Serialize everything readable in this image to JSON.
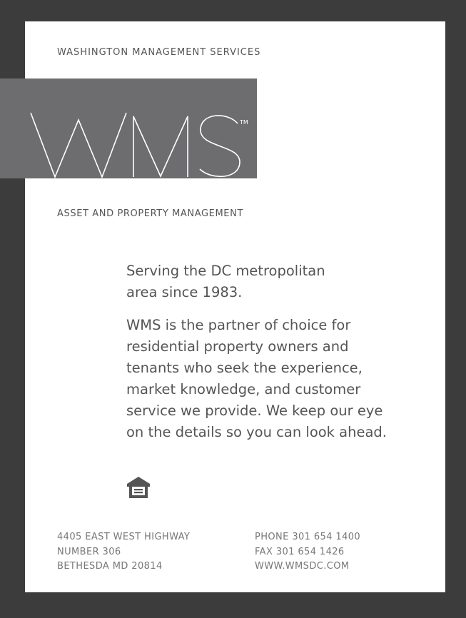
{
  "header": {
    "company_name": "WASHINGTON MANAGEMENT SERVICES"
  },
  "logo": {
    "mark": "WMS",
    "trademark": "TM",
    "block_color": "#6d6d70"
  },
  "tagline": "ASSET AND PROPERTY MANAGEMENT",
  "body": {
    "intro_lines": [
      "Serving the DC metropolitan",
      "area since 1983."
    ],
    "description_lines": [
      "WMS is the partner of choice for",
      "residential property owners and",
      "tenants who seek the experience,",
      "market knowledge, and customer",
      "service we provide. We keep our eye",
      "on the details so you can look ahead."
    ]
  },
  "icon": {
    "name": "equal-housing-opportunity-icon"
  },
  "footer": {
    "address": {
      "line1": "4405 EAST WEST HIGHWAY",
      "line2": "NUMBER 306",
      "line3": "BETHESDA MD 20814"
    },
    "contact": {
      "phone": "PHONE 301 654 1400",
      "fax": "FAX 301 654 1426",
      "website": "WWW.WMSDC.COM"
    }
  },
  "colors": {
    "background": "#3c3c3c",
    "card": "#ffffff",
    "text": "#555555",
    "footer_text": "#777777"
  }
}
